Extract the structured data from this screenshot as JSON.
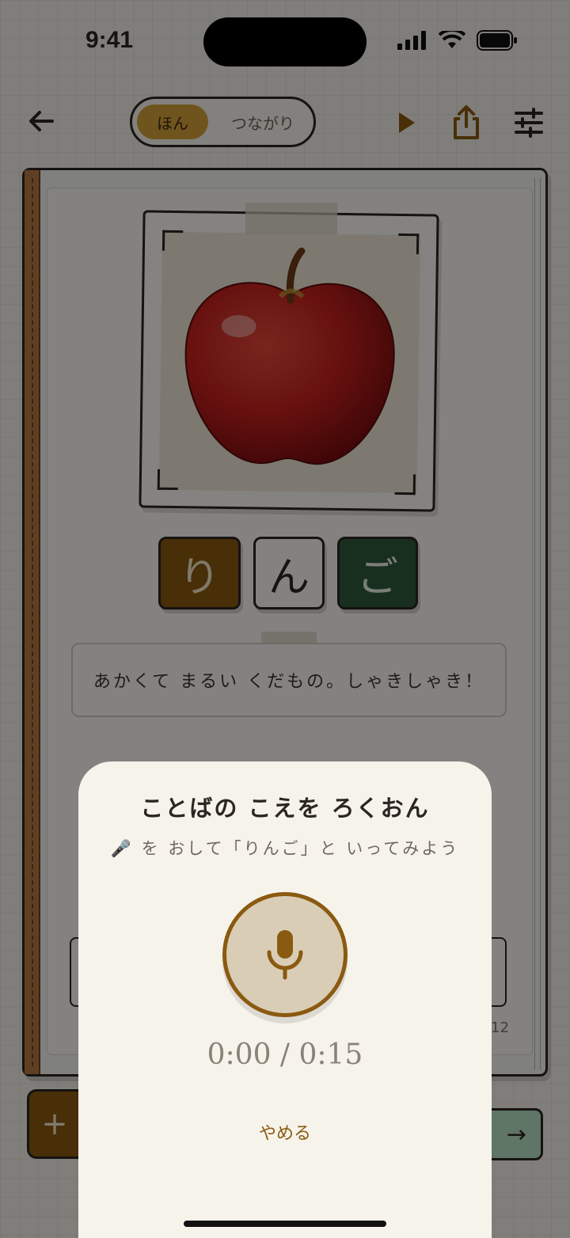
{
  "status": {
    "time": "9:41"
  },
  "top_bar": {
    "segments": {
      "active": "ほん",
      "inactive": "つながり"
    }
  },
  "card": {
    "image_subject": "apple",
    "tiles": [
      "り",
      "ん",
      "ご"
    ],
    "description": "あかくて まるい くだもの。しゃきしゃき！",
    "side_label_right": "12"
  },
  "colors": {
    "accent_gold": "#d6a23a",
    "tile_brown": "#8a5a10",
    "tile_green": "#2e5a3c",
    "next_green": "#b7e0c3",
    "sheet_bg": "#f6f3eb"
  },
  "record_sheet": {
    "title": "ことばの こえを ろくおん",
    "mic_emoji": "🎤",
    "subtitle_text": "を おして「りんご」と いってみよう",
    "timer": "0:00 / 0:15",
    "cancel_label": "やめる"
  }
}
